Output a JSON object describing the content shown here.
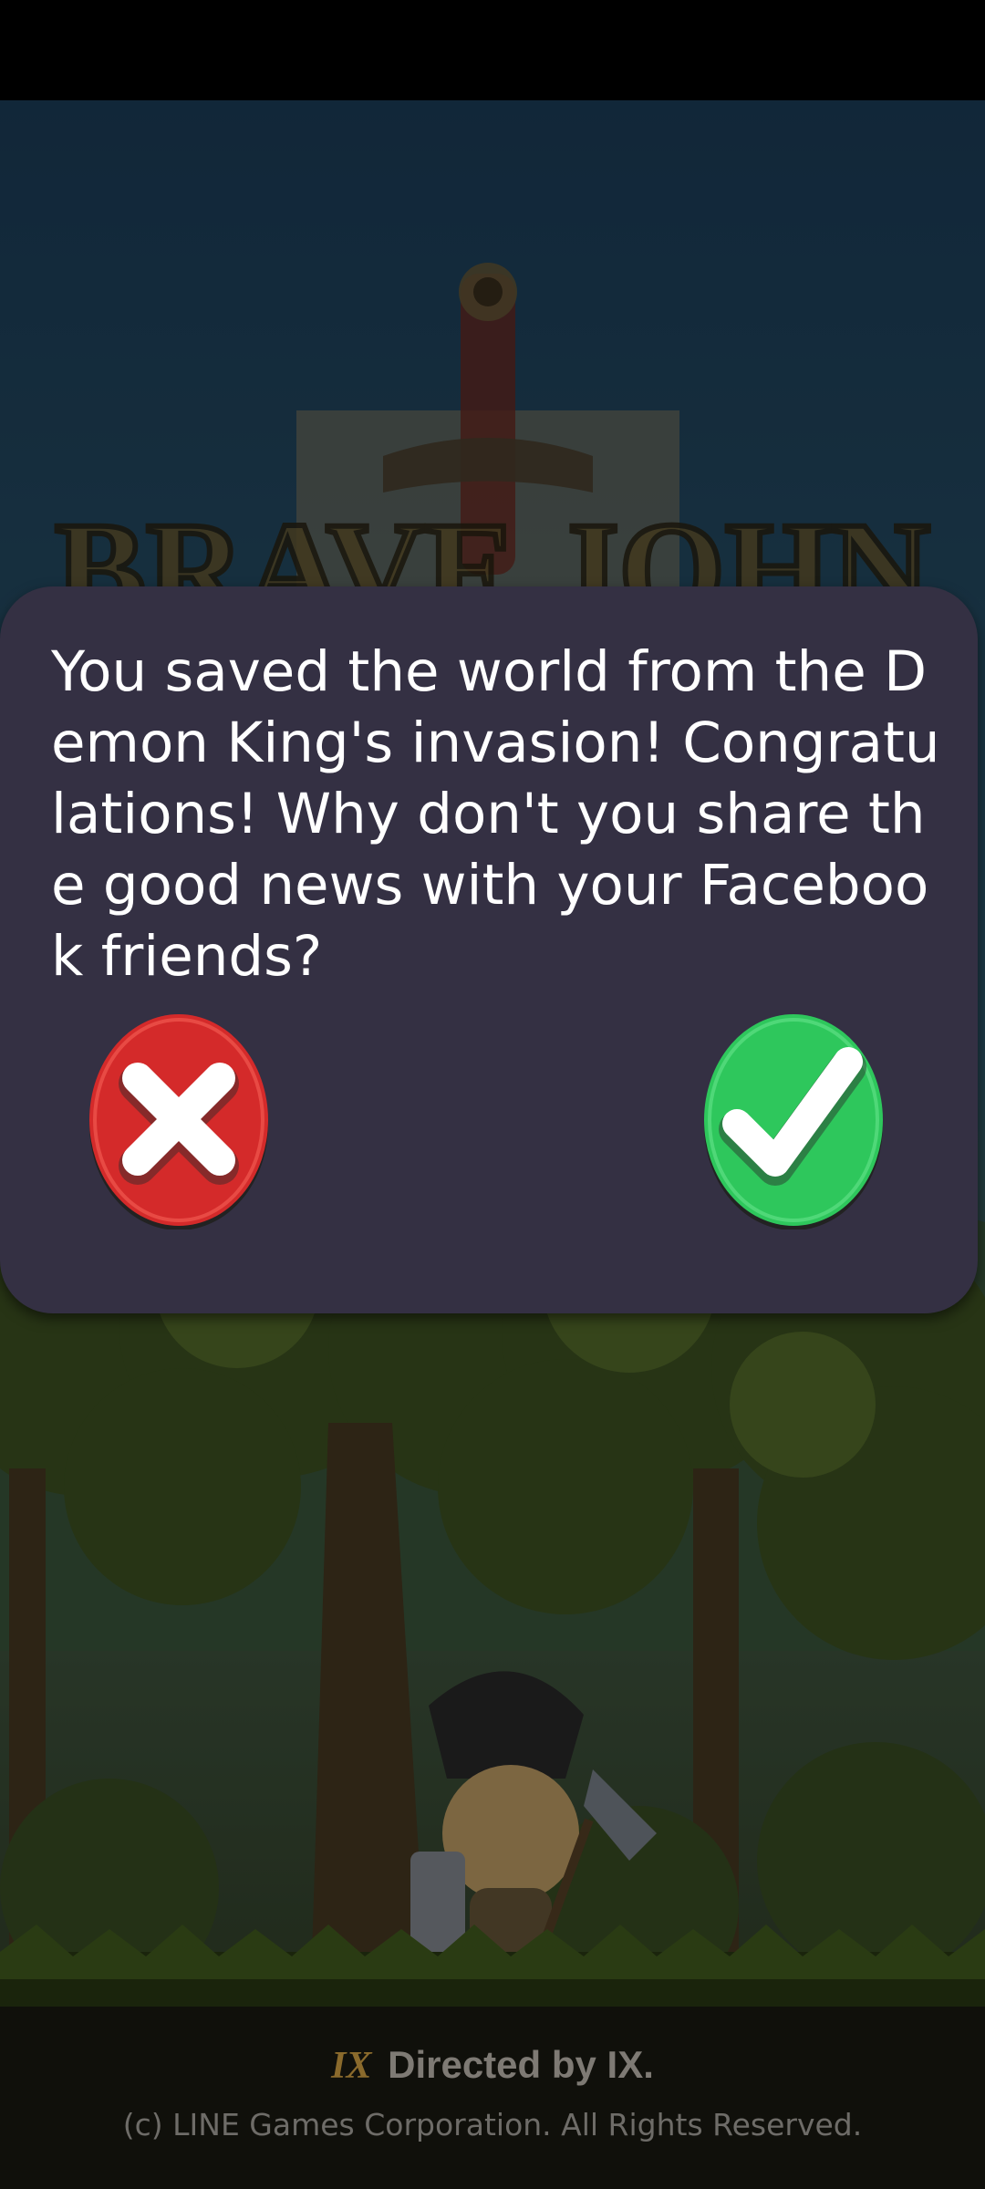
{
  "dialog": {
    "message": "You saved the world from the Demon King's invasion! Congratulations! Why don't you share the good news with your Facebook friends?",
    "cancel_icon": "close-x-icon",
    "confirm_icon": "check-icon"
  },
  "background": {
    "logo_text": "BRAVE JOHN"
  },
  "footer": {
    "logo_mark": "IX",
    "directed_by": "Directed by IX.",
    "copyright": "(c) LINE Games Corporation. All Rights Reserved."
  },
  "colors": {
    "dialog_bg": "#343043",
    "cancel_red": "#d42a2a",
    "confirm_green": "#2ec75c"
  }
}
